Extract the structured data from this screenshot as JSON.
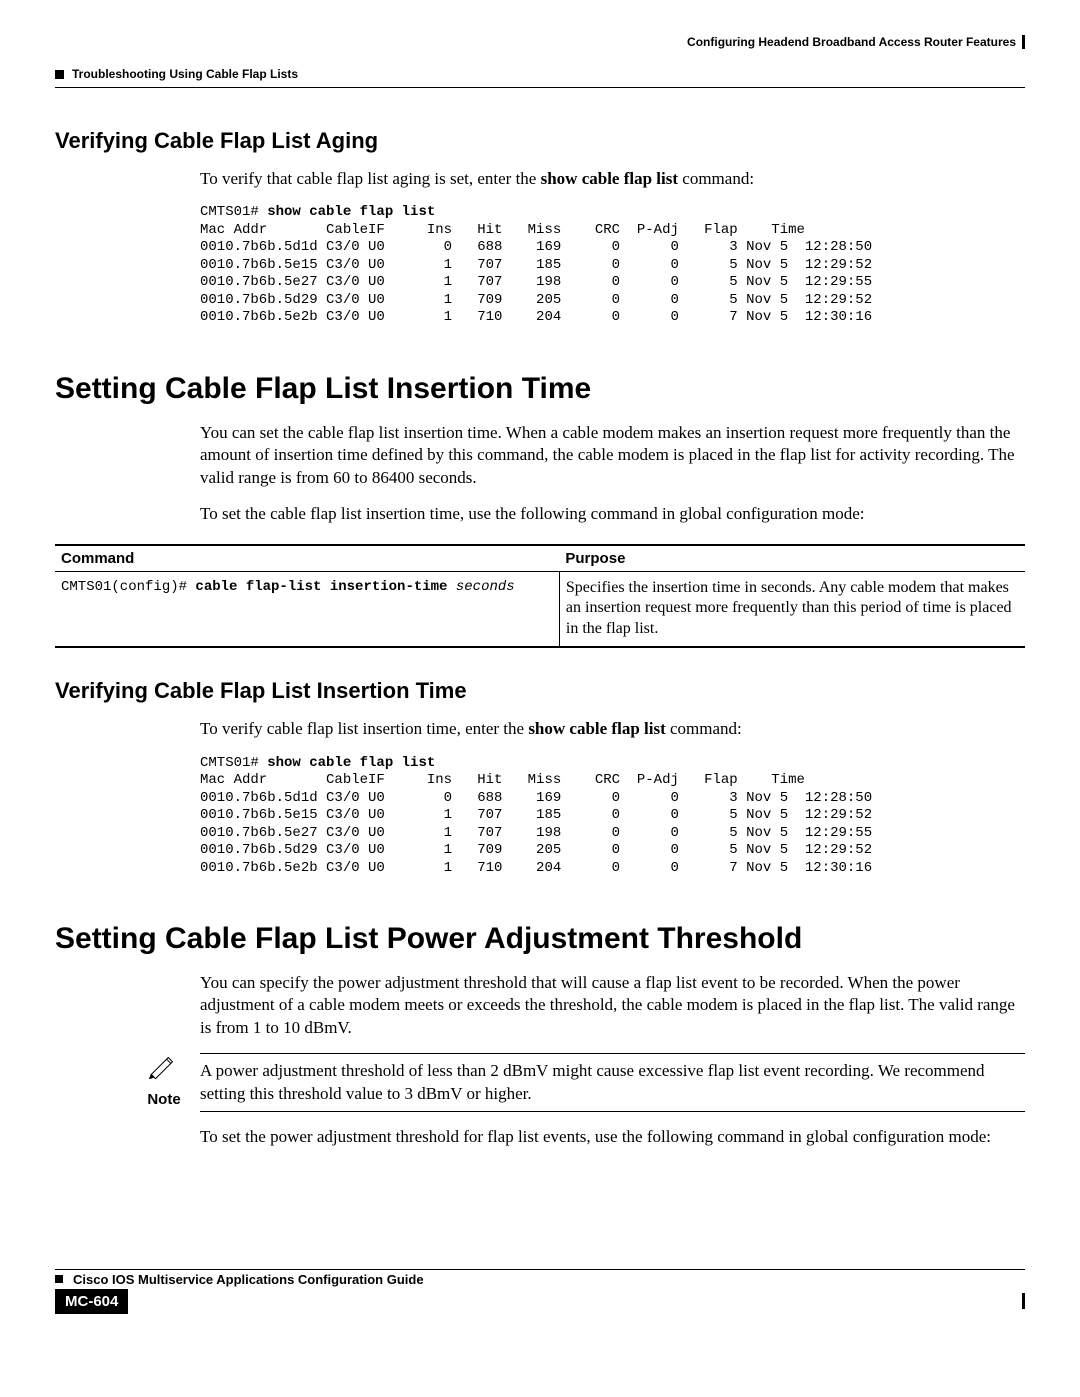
{
  "header": {
    "left_marker": "■",
    "left_text": "Troubleshooting Using Cable Flap Lists",
    "right_text": "Configuring Headend Broadband Access Router Features"
  },
  "sec_aging": {
    "title": "Verifying Cable Flap List Aging",
    "intro_pre": "To verify that cable flap list aging is set, enter the ",
    "intro_bold": "show cable flap list",
    "intro_post": " command:"
  },
  "term_a": {
    "prompt": "CMTS01# ",
    "cmd": "show cable flap list",
    "cols": "Mac Addr       CableIF     Ins   Hit   Miss    CRC  P-Adj   Flap    Time",
    "r1": "0010.7b6b.5d1d C3/0 U0       0   688    169      0      0      3 Nov 5  12:28:50",
    "r2": "0010.7b6b.5e15 C3/0 U0       1   707    185      0      0      5 Nov 5  12:29:52",
    "r3": "0010.7b6b.5e27 C3/0 U0       1   707    198      0      0      5 Nov 5  12:29:55",
    "r4": "0010.7b6b.5d29 C3/0 U0       1   709    205      0      0      5 Nov 5  12:29:52",
    "r5": "0010.7b6b.5e2b C3/0 U0       1   710    204      0      0      7 Nov 5  12:30:16"
  },
  "sec_insertion": {
    "title": "Setting Cable Flap List Insertion Time",
    "p1": "You can set the cable flap list insertion time. When a cable modem makes an insertion request more frequently than the amount of insertion time defined by this command, the cable modem is placed in the flap list for activity recording. The valid range is from 60 to 86400 seconds.",
    "p2": "To set the cable flap list insertion time, use the following command in global configuration mode:",
    "th_cmd": "Command",
    "th_purpose": "Purpose",
    "cmd_prefix": "CMTS01(config)# ",
    "cmd_bold": "cable flap-list insertion-time ",
    "cmd_arg": "seconds",
    "purpose": "Specifies the insertion time in seconds. Any cable modem that makes an insertion request more frequently than this period of time is placed in the flap list."
  },
  "sec_verify_ins": {
    "title": "Verifying Cable Flap List Insertion Time",
    "intro_pre": "To verify cable flap list insertion time, enter the ",
    "intro_bold": "show cable flap list",
    "intro_post": " command:"
  },
  "sec_power": {
    "title": "Setting Cable Flap List Power Adjustment Threshold",
    "p1": "You can specify the power adjustment threshold that will cause a flap list event to be recorded. When the power adjustment of a cable modem meets or exceeds the threshold, the cable modem is placed in the flap list. The valid range is from 1 to 10 dBmV.",
    "note_label": "Note",
    "note_text": "A power adjustment threshold of less than 2 dBmV might cause excessive flap list event recording. We recommend setting this threshold value to 3 dBmV or higher.",
    "p2": "To set the power adjustment threshold for flap list events, use the following command in global configuration mode:"
  },
  "footer": {
    "guide": "Cisco IOS Multiservice Applications Configuration Guide",
    "page": "MC-604"
  }
}
